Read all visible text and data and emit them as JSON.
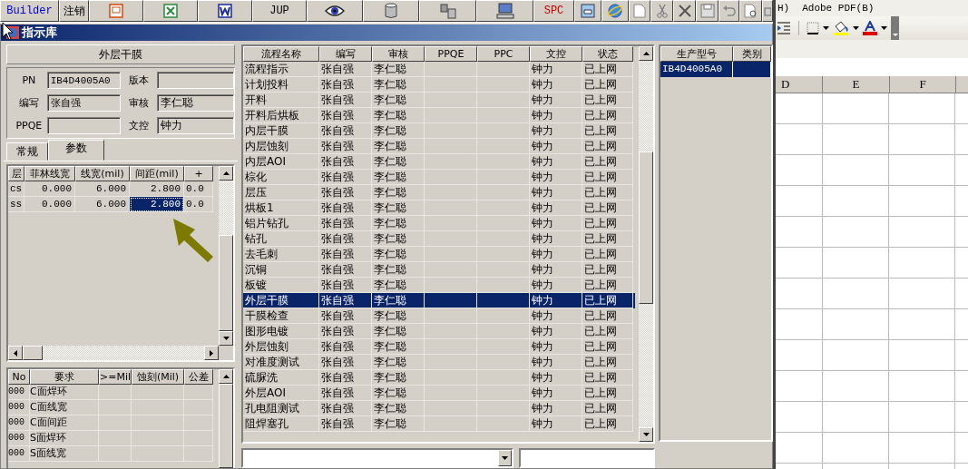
{
  "toolbar": [
    {
      "kind": "text",
      "label": "Builder",
      "color": "#0000cc"
    },
    {
      "kind": "text",
      "label": "注销",
      "color": "#000000"
    },
    {
      "kind": "icon"
    },
    {
      "kind": "icon"
    },
    {
      "kind": "icon"
    },
    {
      "kind": "text",
      "label": "JUP",
      "color": "#000000"
    },
    {
      "kind": "icon"
    },
    {
      "kind": "icon"
    },
    {
      "kind": "icon"
    },
    {
      "kind": "icon"
    },
    {
      "kind": "text",
      "label": "SPC",
      "color": "#cc0000"
    },
    {
      "kind": "icon"
    },
    {
      "kind": "icon"
    },
    {
      "kind": "icon"
    },
    {
      "kind": "icon"
    },
    {
      "kind": "icon"
    },
    {
      "kind": "icon"
    },
    {
      "kind": "icon"
    },
    {
      "kind": "icon"
    },
    {
      "kind": "icon"
    }
  ],
  "window": {
    "title": "指示库"
  },
  "process_header": "外层干膜",
  "fields": [
    {
      "label": "PN",
      "value": "IB4D4005A0"
    },
    {
      "label": "版本"
    },
    {
      "label": "编写",
      "value": "张自强"
    },
    {
      "label": "审核",
      "value": "李仁聪"
    },
    {
      "label": "PPQE"
    },
    {
      "label": "文控",
      "value": "钟力"
    }
  ],
  "tabs": [
    {
      "label": "常规",
      "selected": false
    },
    {
      "label": "参数",
      "selected": true
    }
  ],
  "param_table": {
    "columns": [
      "层",
      "菲林线宽",
      "线宽(mil)",
      "间距(mil)",
      "+"
    ],
    "rows": [
      {
        "cells": [
          {
            "text": "cs",
            "selected": false
          },
          {
            "text": "0.000",
            "selected": false
          },
          {
            "text": "6.000",
            "selected": false
          },
          {
            "text": "2.800",
            "selected": false
          },
          {
            "text": "0.0",
            "selected": false
          }
        ]
      },
      {
        "cells": [
          {
            "text": "ss",
            "selected": false
          },
          {
            "text": "0.000",
            "selected": false
          },
          {
            "text": "6.000",
            "selected": false
          },
          {
            "text": "2.800",
            "selected": true
          },
          {
            "text": "0.0",
            "selected": false
          }
        ]
      }
    ]
  },
  "requirements_table": {
    "columns": [
      "No",
      "要求",
      ">=Mil",
      "蚀刻(Mil)",
      "公差"
    ],
    "rows": [
      [
        "000",
        "C面焊环"
      ],
      [
        "000",
        "C面线宽"
      ],
      [
        "000",
        "C面间距"
      ],
      [
        "000",
        "S面焊环"
      ],
      [
        "000",
        "S面线宽"
      ]
    ]
  },
  "process_table": {
    "columns": [
      "流程名称",
      "编写",
      "审核",
      "PPQE",
      "PPC",
      "文控",
      "状态"
    ],
    "rows": [
      {
        "name": "流程指示",
        "author": "张自强",
        "reviewer": "李仁聪",
        "control": "钟力",
        "status": "已上网",
        "selected": false
      },
      {
        "name": "计划投料",
        "author": "张自强",
        "reviewer": "李仁聪",
        "control": "钟力",
        "status": "已上网",
        "selected": false
      },
      {
        "name": "开料",
        "author": "张自强",
        "reviewer": "李仁聪",
        "control": "钟力",
        "status": "已上网",
        "selected": false
      },
      {
        "name": "开料后烘板",
        "author": "张自强",
        "reviewer": "李仁聪",
        "control": "钟力",
        "status": "已上网",
        "selected": false
      },
      {
        "name": "内层干膜",
        "author": "张自强",
        "reviewer": "李仁聪",
        "control": "钟力",
        "status": "已上网",
        "selected": false
      },
      {
        "name": "内层蚀刻",
        "author": "张自强",
        "reviewer": "李仁聪",
        "control": "钟力",
        "status": "已上网",
        "selected": false
      },
      {
        "name": "内层AOI",
        "author": "张自强",
        "reviewer": "李仁聪",
        "control": "钟力",
        "status": "已上网",
        "selected": false
      },
      {
        "name": "棕化",
        "author": "张自强",
        "reviewer": "李仁聪",
        "control": "钟力",
        "status": "已上网",
        "selected": false
      },
      {
        "name": "层压",
        "author": "张自强",
        "reviewer": "李仁聪",
        "control": "钟力",
        "status": "已上网",
        "selected": false
      },
      {
        "name": "烘板1",
        "author": "张自强",
        "reviewer": "李仁聪",
        "control": "钟力",
        "status": "已上网",
        "selected": false
      },
      {
        "name": "铝片钻孔",
        "author": "张自强",
        "reviewer": "李仁聪",
        "control": "钟力",
        "status": "已上网",
        "selected": false
      },
      {
        "name": "钻孔",
        "author": "张自强",
        "reviewer": "李仁聪",
        "control": "钟力",
        "status": "已上网",
        "selected": false
      },
      {
        "name": "去毛刺",
        "author": "张自强",
        "reviewer": "李仁聪",
        "control": "钟力",
        "status": "已上网",
        "selected": false
      },
      {
        "name": "沉铜",
        "author": "张自强",
        "reviewer": "李仁聪",
        "control": "钟力",
        "status": "已上网",
        "selected": false
      },
      {
        "name": "板镀",
        "author": "张自强",
        "reviewer": "李仁聪",
        "control": "钟力",
        "status": "已上网",
        "selected": false
      },
      {
        "name": "外层干膜",
        "author": "张自强",
        "reviewer": "李仁聪",
        "control": "钟力",
        "status": "已上网",
        "selected": true
      },
      {
        "name": "干膜检查",
        "author": "张自强",
        "reviewer": "李仁聪",
        "control": "钟力",
        "status": "已上网",
        "selected": false
      },
      {
        "name": "图形电镀",
        "author": "张自强",
        "reviewer": "李仁聪",
        "control": "钟力",
        "status": "已上网",
        "selected": false
      },
      {
        "name": "外层蚀刻",
        "author": "张自强",
        "reviewer": "李仁聪",
        "control": "钟力",
        "status": "已上网",
        "selected": false
      },
      {
        "name": "对准度测试",
        "author": "张自强",
        "reviewer": "李仁聪",
        "control": "钟力",
        "status": "已上网",
        "selected": false
      },
      {
        "name": "硫脲洗",
        "author": "张自强",
        "reviewer": "李仁聪",
        "control": "钟力",
        "status": "已上网",
        "selected": false
      },
      {
        "name": "外层AOI",
        "author": "张自强",
        "reviewer": "李仁聪",
        "control": "钟力",
        "status": "已上网",
        "selected": false
      },
      {
        "name": "孔电阻测试",
        "author": "张自强",
        "reviewer": "李仁聪",
        "control": "钟力",
        "status": "已上网",
        "selected": false
      },
      {
        "name": "阻焊塞孔",
        "author": "张自强",
        "reviewer": "李仁聪",
        "control": "钟力",
        "status": "已上网",
        "selected": false
      }
    ]
  },
  "model_table": {
    "columns": [
      "生产型号",
      "类别"
    ],
    "rows": [
      {
        "model": "IB4D4005A0",
        "selected": true
      }
    ]
  },
  "spreadsheet": {
    "menu": [
      "H)",
      "Adobe PDF(B)"
    ],
    "columns": [
      "D",
      "E",
      "F"
    ]
  }
}
